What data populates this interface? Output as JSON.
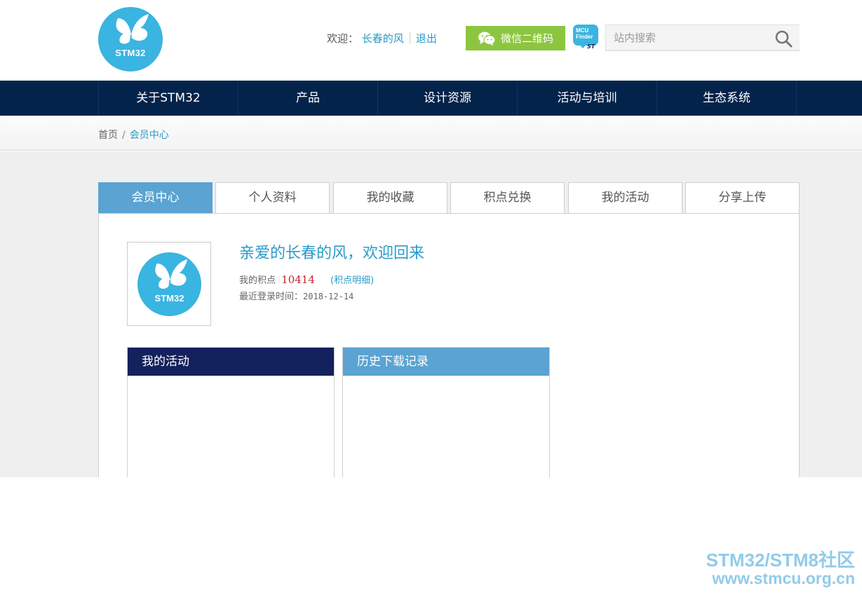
{
  "header": {
    "logo_text": "STM32",
    "welcome_label": "欢迎：",
    "username": "长春的风",
    "logout": "退出",
    "wechat_button": "微信二维码",
    "mcu_finder": "MCU Finder",
    "mcu_finder_brand": "ST",
    "search_placeholder": "站内搜索"
  },
  "nav": {
    "items": [
      "关于STM32",
      "产品",
      "设计资源",
      "活动与培训",
      "生态系统"
    ]
  },
  "breadcrumb": {
    "home": "首页",
    "separator": "/",
    "current": "会员中心"
  },
  "tabs": {
    "items": [
      "会员中心",
      "个人资料",
      "我的收藏",
      "积点兑换",
      "我的活动",
      "分享上传"
    ],
    "active": "会员中心"
  },
  "profile": {
    "greeting": "亲爱的长春的风，欢迎回来",
    "points_label": "我的积点",
    "points_value": "10414",
    "points_detail": "(积点明细)",
    "last_login_label": "最近登录时间：",
    "last_login_date": "2018-12-14"
  },
  "boxes": {
    "activities_title": "我的活动",
    "downloads_title": "历史下载记录"
  },
  "watermark": {
    "line1": "STM32/STM8社区",
    "line2": "www.stmcu.org.cn"
  },
  "colors": {
    "navy": "#03234b",
    "accent_blue": "#2a9bc9",
    "tab_active": "#5aa3d2",
    "wechat_green": "#8cc63f",
    "box_dark": "#13215c",
    "points_red": "#c1272d",
    "logo_cyan": "#3ab4e0"
  }
}
